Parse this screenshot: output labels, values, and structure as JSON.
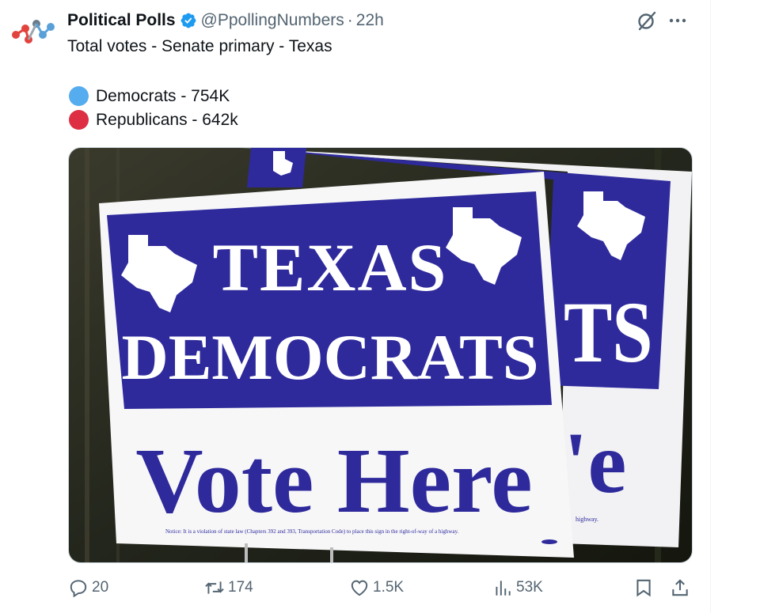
{
  "tweet": {
    "author_name": "Political Polls",
    "handle": "@PpollingNumbers",
    "separator": "·",
    "time": "22h",
    "line1": "Total votes - Senate primary - Texas",
    "dem_line": "Democrats - 754K",
    "rep_line": "Republicans - 642k",
    "dem_color": "#55acee",
    "rep_color": "#dd2e44"
  },
  "image": {
    "sign_line1": "TEXAS",
    "sign_line2": "DEMOCRATS",
    "sign_line3": "Vote Here",
    "back_sign_fragment": "TS",
    "back_sign_bottom": "'e",
    "back_sign_fineprint": "highway.",
    "fineprint": "Notice: It is a violation of state law (Chapters 392 and 393, Transportation Code) to place this sign in the right-of-way of a highway.",
    "sign_blue": "#2e2a9c"
  },
  "actions": {
    "replies": "20",
    "reposts": "174",
    "likes": "1.5K",
    "views": "53K"
  },
  "colors": {
    "muted": "#536471",
    "verified": "#1d9bf0"
  }
}
